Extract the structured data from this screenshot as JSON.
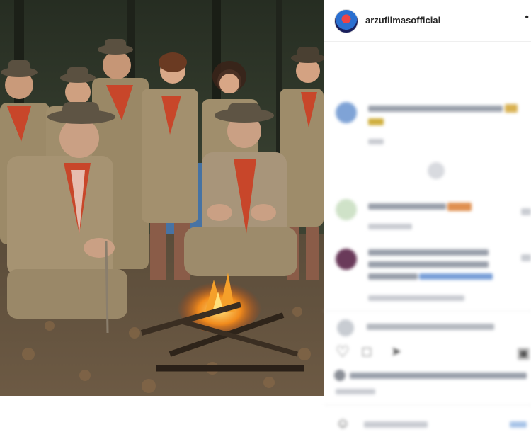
{
  "post": {
    "username": "arzufilmasofficial",
    "more_label": "•"
  },
  "colors": {
    "scout_uniform": "#9c8a68",
    "scarf_red": "#c8462a",
    "forest": "#2c3424",
    "fire": "#f08a1c"
  },
  "icons": [
    "more-options-icon",
    "like-icon",
    "comment-icon",
    "share-icon",
    "save-icon",
    "emoji-icon"
  ]
}
